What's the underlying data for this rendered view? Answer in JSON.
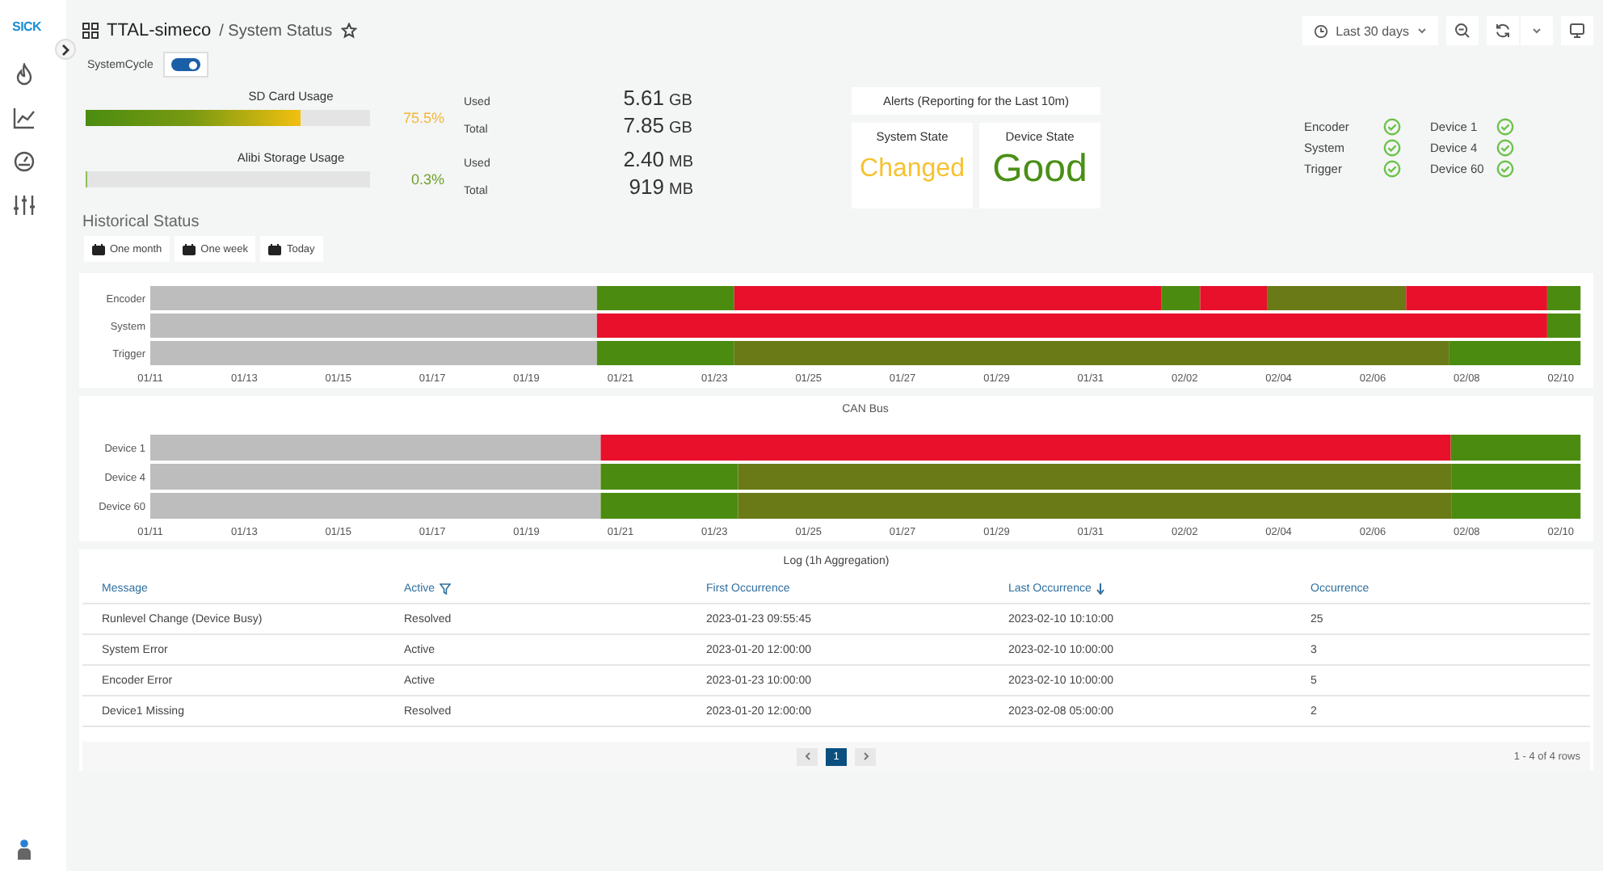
{
  "sidebar": {
    "logo": "SICK"
  },
  "header": {
    "title": "TTAL-simeco",
    "subtitle": "/ System Status",
    "time_range": "Last 30 days"
  },
  "system_cycle": {
    "label": "SystemCycle",
    "on": true
  },
  "storage": [
    {
      "title": "SD Card Usage",
      "level": 0.755,
      "percent": "75.5%",
      "used_label": "Used",
      "used": "5.61",
      "used_unit": "GB",
      "total_label": "Total",
      "total": "7.85",
      "total_unit": "GB"
    },
    {
      "title": "Alibi Storage Usage",
      "level": 0.003,
      "percent": "0.3%",
      "used_label": "Used",
      "used": "2.40",
      "used_unit": "MB",
      "total_label": "Total",
      "total": "919",
      "total_unit": "MB"
    }
  ],
  "alerts": {
    "title": "Alerts (Reporting for the Last 10m)",
    "states": [
      {
        "label": "System State",
        "value": "Changed",
        "kind": "warning"
      },
      {
        "label": "Device State",
        "value": "Good",
        "kind": "good"
      }
    ]
  },
  "components": [
    {
      "name": "Encoder",
      "ok": true
    },
    {
      "name": "System",
      "ok": true
    },
    {
      "name": "Trigger",
      "ok": true
    },
    {
      "name": "Device 1",
      "ok": true
    },
    {
      "name": "Device 4",
      "ok": true
    },
    {
      "name": "Device 60",
      "ok": true
    }
  ],
  "historical": {
    "title": "Historical Status",
    "ranges": [
      {
        "label": "One month"
      },
      {
        "label": "One week"
      },
      {
        "label": "Today"
      }
    ]
  },
  "timelines": [
    {
      "axis_labels": [
        "01/11",
        "01/13",
        "01/15",
        "01/17",
        "01/19",
        "01/21",
        "01/23",
        "01/25",
        "01/27",
        "01/29",
        "01/31",
        "02/02",
        "02/04",
        "02/06",
        "02/08",
        "02/10"
      ],
      "rows": [
        {
          "name": "Encoder",
          "segments": [
            {
              "kind": "none"
            },
            {
              "kind": "ok"
            },
            {
              "kind": "error"
            },
            {
              "kind": "ok"
            },
            {
              "kind": "error"
            },
            {
              "kind": "mixed"
            },
            {
              "kind": "error"
            },
            {
              "kind": "ok"
            }
          ]
        },
        {
          "name": "System",
          "segments": [
            {
              "kind": "none"
            },
            {
              "kind": "error"
            },
            {
              "kind": "ok"
            }
          ]
        },
        {
          "name": "Trigger",
          "segments": [
            {
              "kind": "none"
            },
            {
              "kind": "ok"
            },
            {
              "kind": "mixed"
            },
            {
              "kind": "ok"
            }
          ]
        }
      ]
    },
    {
      "axis_labels": [
        "01/11",
        "01/13",
        "01/15",
        "01/17",
        "01/19",
        "01/21",
        "01/23",
        "01/25",
        "01/27",
        "01/29",
        "01/31",
        "02/02",
        "02/04",
        "02/06",
        "02/08",
        "02/10"
      ],
      "title": "CAN Bus",
      "rows": [
        {
          "name": "Device 1",
          "segments": [
            {
              "kind": "none"
            },
            {
              "kind": "error"
            },
            {
              "kind": "ok"
            }
          ]
        },
        {
          "name": "Device 4",
          "segments": [
            {
              "kind": "none"
            },
            {
              "kind": "ok"
            },
            {
              "kind": "mixed"
            },
            {
              "kind": "ok"
            }
          ]
        },
        {
          "name": "Device 60",
          "segments": [
            {
              "kind": "none"
            },
            {
              "kind": "ok"
            },
            {
              "kind": "mixed"
            },
            {
              "kind": "ok"
            }
          ]
        }
      ]
    }
  ],
  "log": {
    "title": "Log (1h Aggregation)",
    "columns": [
      {
        "label": "Message"
      },
      {
        "label": "Active",
        "filter": true
      },
      {
        "label": "First Occurrence"
      },
      {
        "label": "Last Occurrence",
        "sorted": true
      },
      {
        "label": "Occurrence"
      }
    ],
    "rows": [
      [
        "Runlevel Change (Device Busy)",
        "Resolved",
        "2023-01-23 09:55:45",
        "2023-02-10 10:10:00",
        "25"
      ],
      [
        "System Error",
        "Active",
        "2023-01-20 12:00:00",
        "2023-02-10 10:00:00",
        "3"
      ],
      [
        "Encoder Error",
        "Active",
        "2023-01-23 10:00:00",
        "2023-02-10 10:00:00",
        "5"
      ],
      [
        "Device1 Missing",
        "Resolved",
        "2023-01-20 12:00:00",
        "2023-02-08 05:00:00",
        "2"
      ]
    ],
    "pages": [
      {
        "label": "1",
        "selected": true
      }
    ],
    "summary": "1 - 4 of 4 rows"
  }
}
